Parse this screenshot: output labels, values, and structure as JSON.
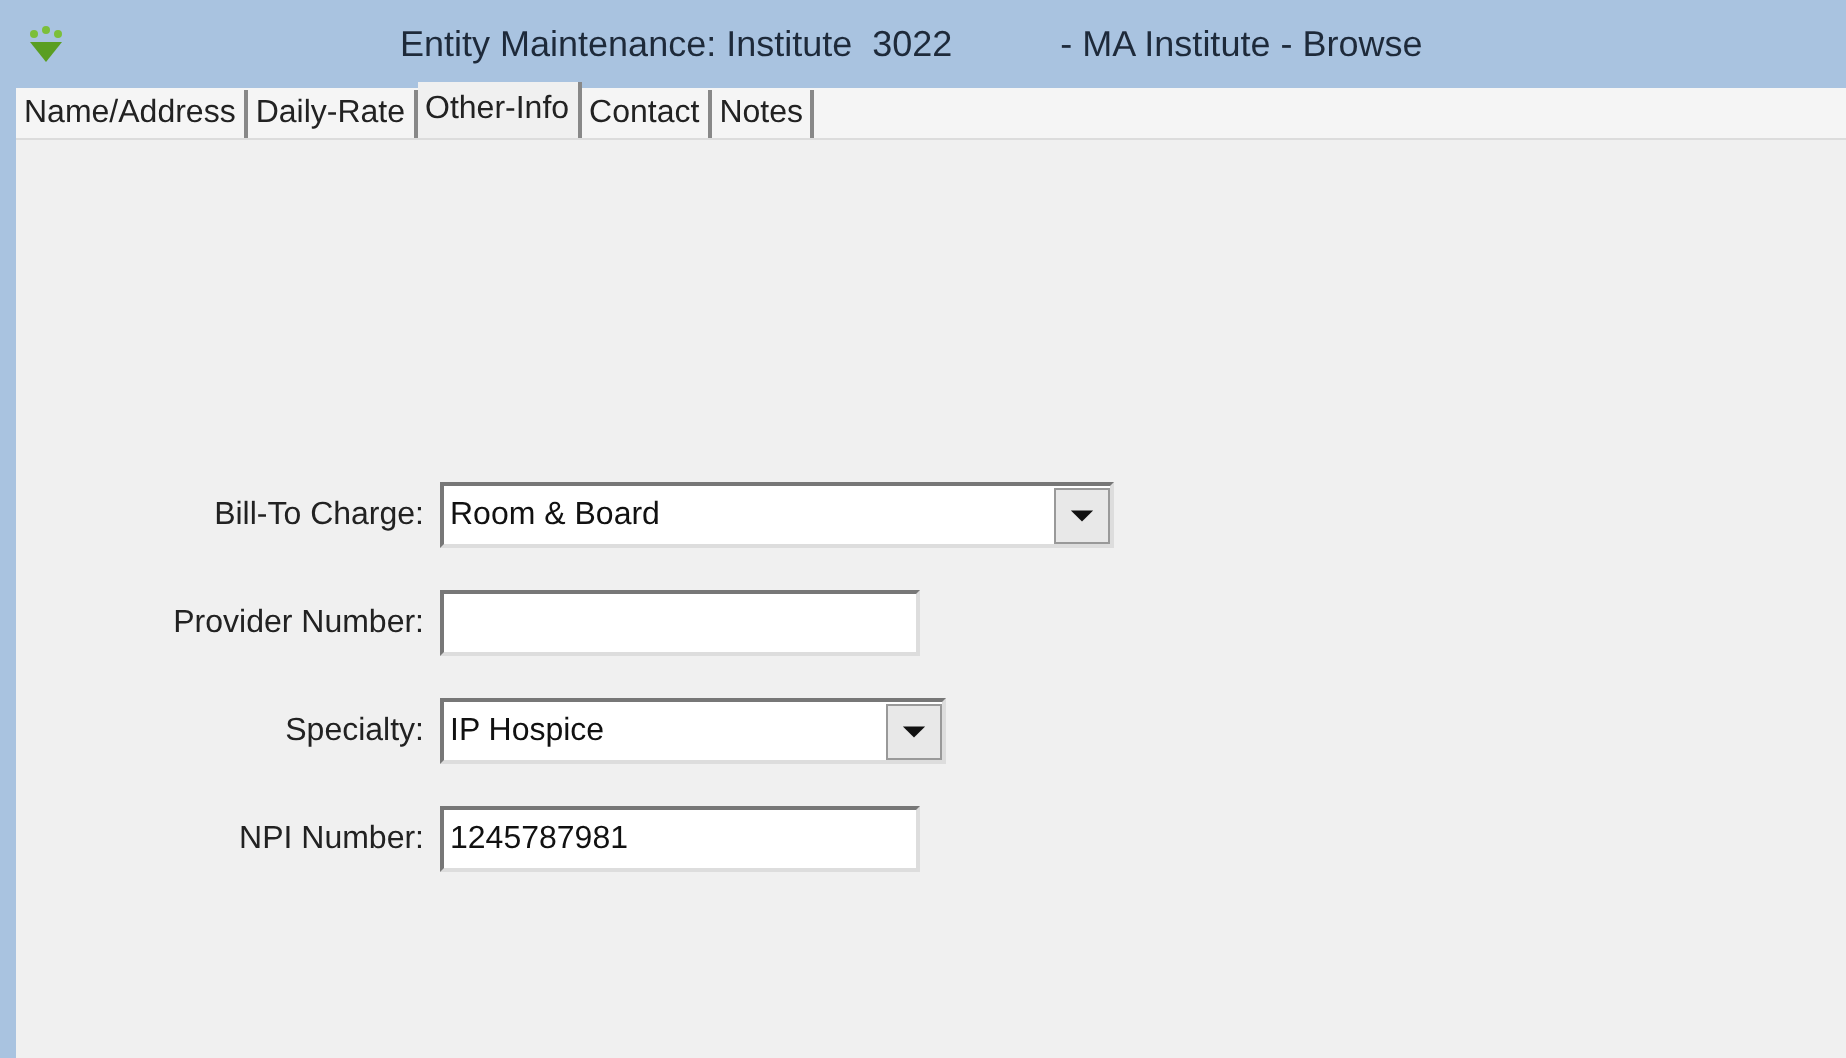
{
  "window": {
    "title": "Entity Maintenance: Institute  3022",
    "subtitle": "- MA Institute - Browse"
  },
  "tabs": [
    {
      "label": "Name/Address",
      "selected": false
    },
    {
      "label": "Daily-Rate",
      "selected": false
    },
    {
      "label": "Other-Info",
      "selected": true
    },
    {
      "label": "Contact",
      "selected": false
    },
    {
      "label": "Notes",
      "selected": false
    }
  ],
  "fields": [
    {
      "kind": "dropdown",
      "label": "Bill-To Charge:",
      "value": "Room & Board"
    },
    {
      "kind": "text",
      "label": "Provider Number:"
    },
    {
      "kind": "dropdown",
      "label": "Specialty:",
      "value": "IP Hospice"
    },
    {
      "kind": "text",
      "label": "NPI Number:",
      "value": "1245787981"
    }
  ]
}
